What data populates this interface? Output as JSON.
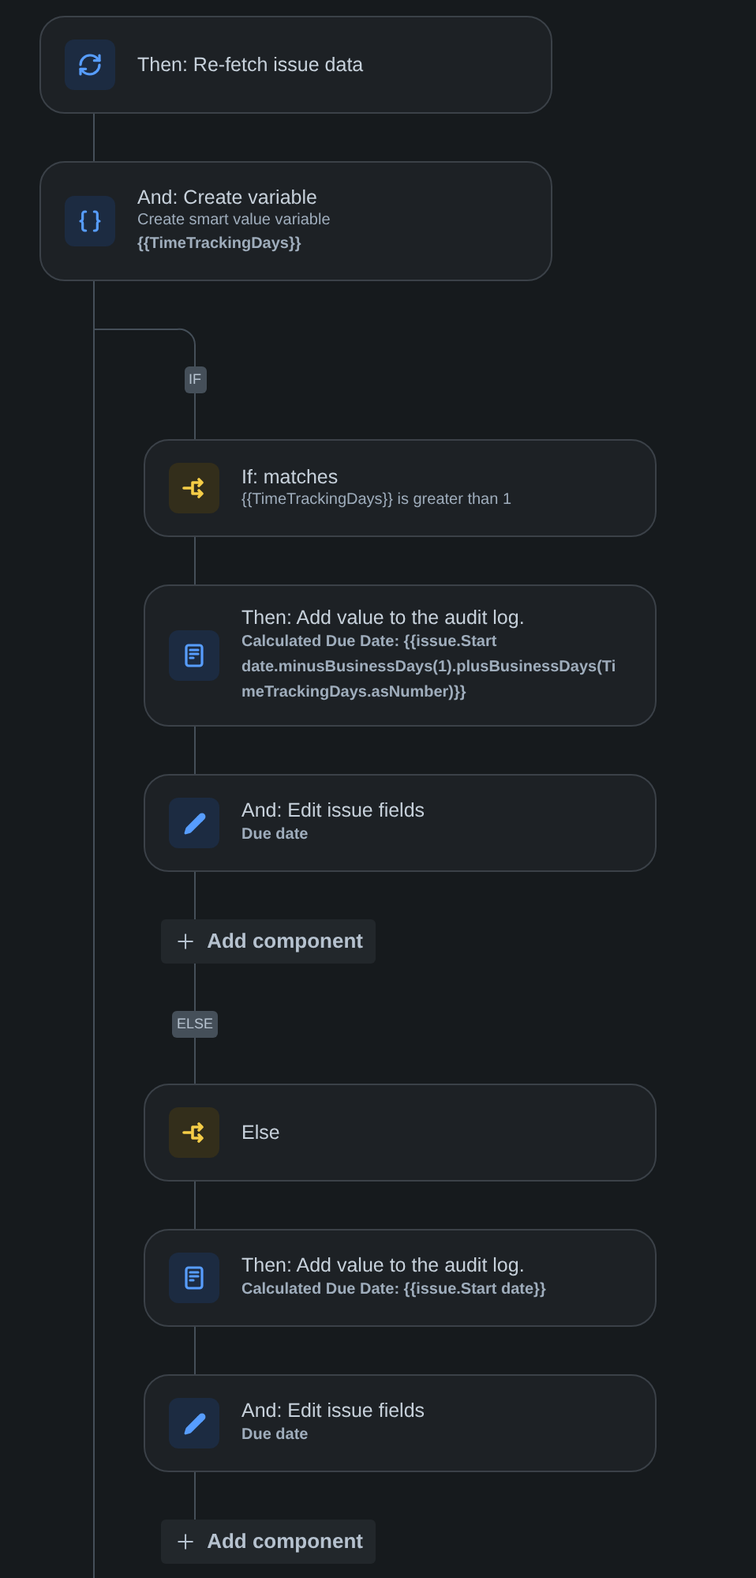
{
  "steps": [
    {
      "kind": "refresh",
      "title": "Then: Re-fetch issue data"
    },
    {
      "kind": "variable",
      "title": "And: Create variable",
      "description": "Create smart value variable",
      "detail": "{{TimeTrackingDays}}"
    }
  ],
  "branches": [
    {
      "label": "IF",
      "steps": [
        {
          "kind": "condition",
          "title": "If: matches",
          "description": "{{TimeTrackingDays}} is greater than 1"
        },
        {
          "kind": "log",
          "title": "Then: Add value to the audit log.",
          "detail": "Calculated Due Date: {{issue.Start date.minusBusinessDays(1).plusBusinessDays(TimeTrackingDays.asNumber)}}"
        },
        {
          "kind": "edit",
          "title": "And: Edit issue fields",
          "detail": "Due date"
        }
      ],
      "add_button": "Add component"
    },
    {
      "label": "ELSE",
      "steps": [
        {
          "kind": "condition",
          "title": "Else"
        },
        {
          "kind": "log",
          "title": "Then: Add value to the audit log.",
          "detail": "Calculated Due Date: {{issue.Start date}}"
        },
        {
          "kind": "edit",
          "title": "And: Edit issue fields",
          "detail": "Due date"
        }
      ],
      "add_button": "Add component"
    }
  ]
}
